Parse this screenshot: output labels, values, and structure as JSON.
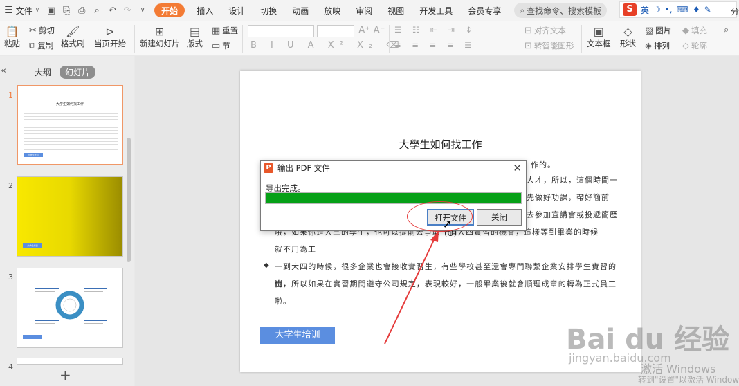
{
  "menubar": {
    "file": "文件",
    "tabs": [
      "开始",
      "插入",
      "设计",
      "切换",
      "动画",
      "放映",
      "审阅",
      "视图",
      "开发工具",
      "会员专享"
    ],
    "active_tab": "开始",
    "search": "查找命令、搜索模板",
    "ime": "英",
    "share": "分"
  },
  "ribbon": {
    "paste": "粘贴",
    "cut": "剪切",
    "copy": "复制",
    "format_painter": "格式刷",
    "from_current": "当页开始",
    "new_slide": "新建幻灯片",
    "layout": "版式",
    "section": "节",
    "reset": "重置",
    "align_text": "对齐文本",
    "smartart": "转智能图形",
    "textbox": "文本框",
    "shape": "形状",
    "arrange": "排列",
    "picture": "图片",
    "fill": "填充",
    "outline": "轮廓"
  },
  "left_panel": {
    "outline_tab": "大纲",
    "slides_tab": "幻灯片",
    "slide_numbers": [
      "1",
      "2",
      "3",
      "4"
    ],
    "thumb1_title": "大学生如何找工作",
    "thumb_button": "大学生培训"
  },
  "slide": {
    "title": "大學生如何找工作",
    "lines": [
      "人才，所以，這個時間一",
      "先做好功課，帶好簡前",
      "去參加宣講會或投遞簡歷",
      "哦，如果你是大三的學生，也可以提前去爭取一個大四實習的機會，這樣等到畢業的時候",
      "就不用為工",
      "一到大四的時候，很多企業也會接收實習生，有些學校甚至還會專門聯繫企業安排學生實習的崗",
      "位，所以如果在實習期間遵守公司規定，表現較好，一般畢業後就會順理成章的轉為正式員工啦。"
    ],
    "top_partial": "作的。",
    "training_button": "大学生培训"
  },
  "dialog": {
    "title": "输出 PDF 文件",
    "message": "导出完成。",
    "progress": 1.0,
    "open_button": "打开文件(O)",
    "close_button": "关闭"
  },
  "watermarks": {
    "baidu": "Bai du 经验",
    "baidu_url": "jingyan.baidu.com",
    "activate": "激活 Windows",
    "activate_sub": "转到\"设置\"以激活 Windows"
  },
  "colors": {
    "accent": "#f37b34",
    "progress": "#06a017",
    "button": "#5b8ee0",
    "annotation": "#e53b3b"
  }
}
